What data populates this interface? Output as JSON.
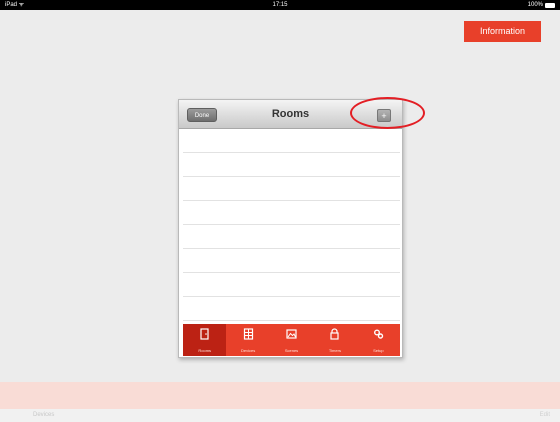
{
  "status_bar": {
    "left": "iPad ᯤ",
    "time": "17:15",
    "battery": "100%"
  },
  "top_button": {
    "label": "Information"
  },
  "panel": {
    "title": "Rooms",
    "done_label": "Done",
    "add_label": "+",
    "rows": [
      "",
      "",
      "",
      "",
      "",
      "",
      "",
      ""
    ]
  },
  "tabs": [
    {
      "label": "Rooms",
      "icon": "door-icon"
    },
    {
      "label": "Devices",
      "icon": "building-icon"
    },
    {
      "label": "Scenes",
      "icon": "image-icon"
    },
    {
      "label": "Timers",
      "icon": "lock-icon"
    },
    {
      "label": "Setup",
      "icon": "gear-icon"
    }
  ],
  "bottom_bar": {
    "left": "Devices",
    "right": "Edit"
  },
  "colors": {
    "accent": "#e8402a",
    "highlight": "#e31e24"
  }
}
